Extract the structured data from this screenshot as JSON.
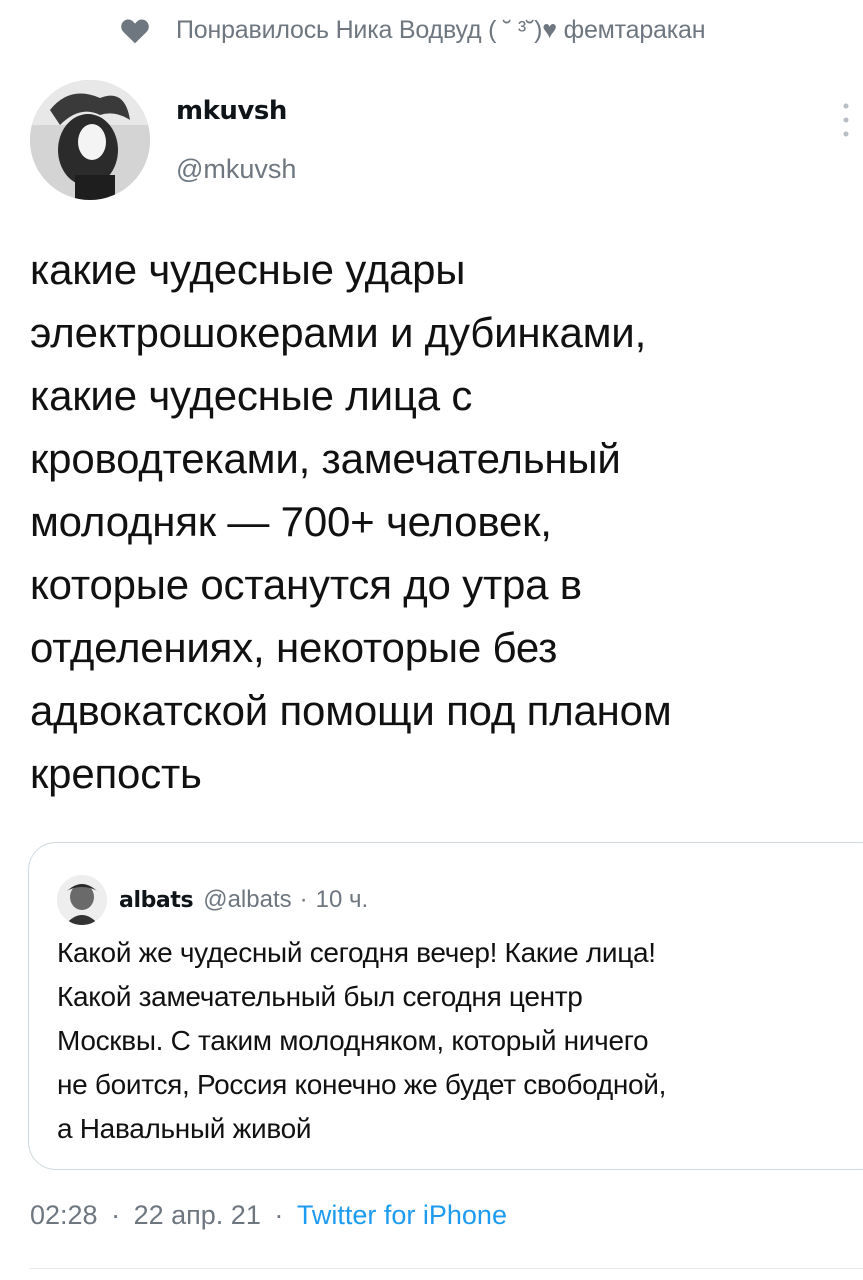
{
  "social_context": {
    "icon": "heart-icon",
    "text": "Понравилось Ника Водвуд ( ˘ ³˘)♥ фемтаракан"
  },
  "author": {
    "display_name": "mkuvsh",
    "handle": "@mkuvsh",
    "avatar": "author-avatar"
  },
  "tweet": {
    "lines": [
      "какие чудесные удары",
      "электрошокерами и дубинками,",
      "какие чудесные лица с",
      "кроводтеками, замечательный",
      "молодняк — 700+ человек,",
      "которые останутся до утра в",
      "отделениях, некоторые без",
      "адвокатской помощи под планом",
      "крепость"
    ]
  },
  "quote": {
    "display_name": "albats",
    "handle": "@albats",
    "separator": "·",
    "time": "10 ч.",
    "lines": [
      "Какой же чудесный сегодня вечер! Какие лица!",
      "Какой замечательный был сегодня центр",
      "Москвы. С таким молодняком, который ничего",
      "не боится, Россия конечно же будет свободной,",
      "а Навальный живой"
    ]
  },
  "meta": {
    "time": "02:28",
    "separator": "·",
    "date": "22 апр. 21",
    "source": "Twitter for iPhone"
  },
  "colors": {
    "secondary_text": "#6e7780",
    "link": "#1d9bf0",
    "border": "#cfd9de"
  }
}
